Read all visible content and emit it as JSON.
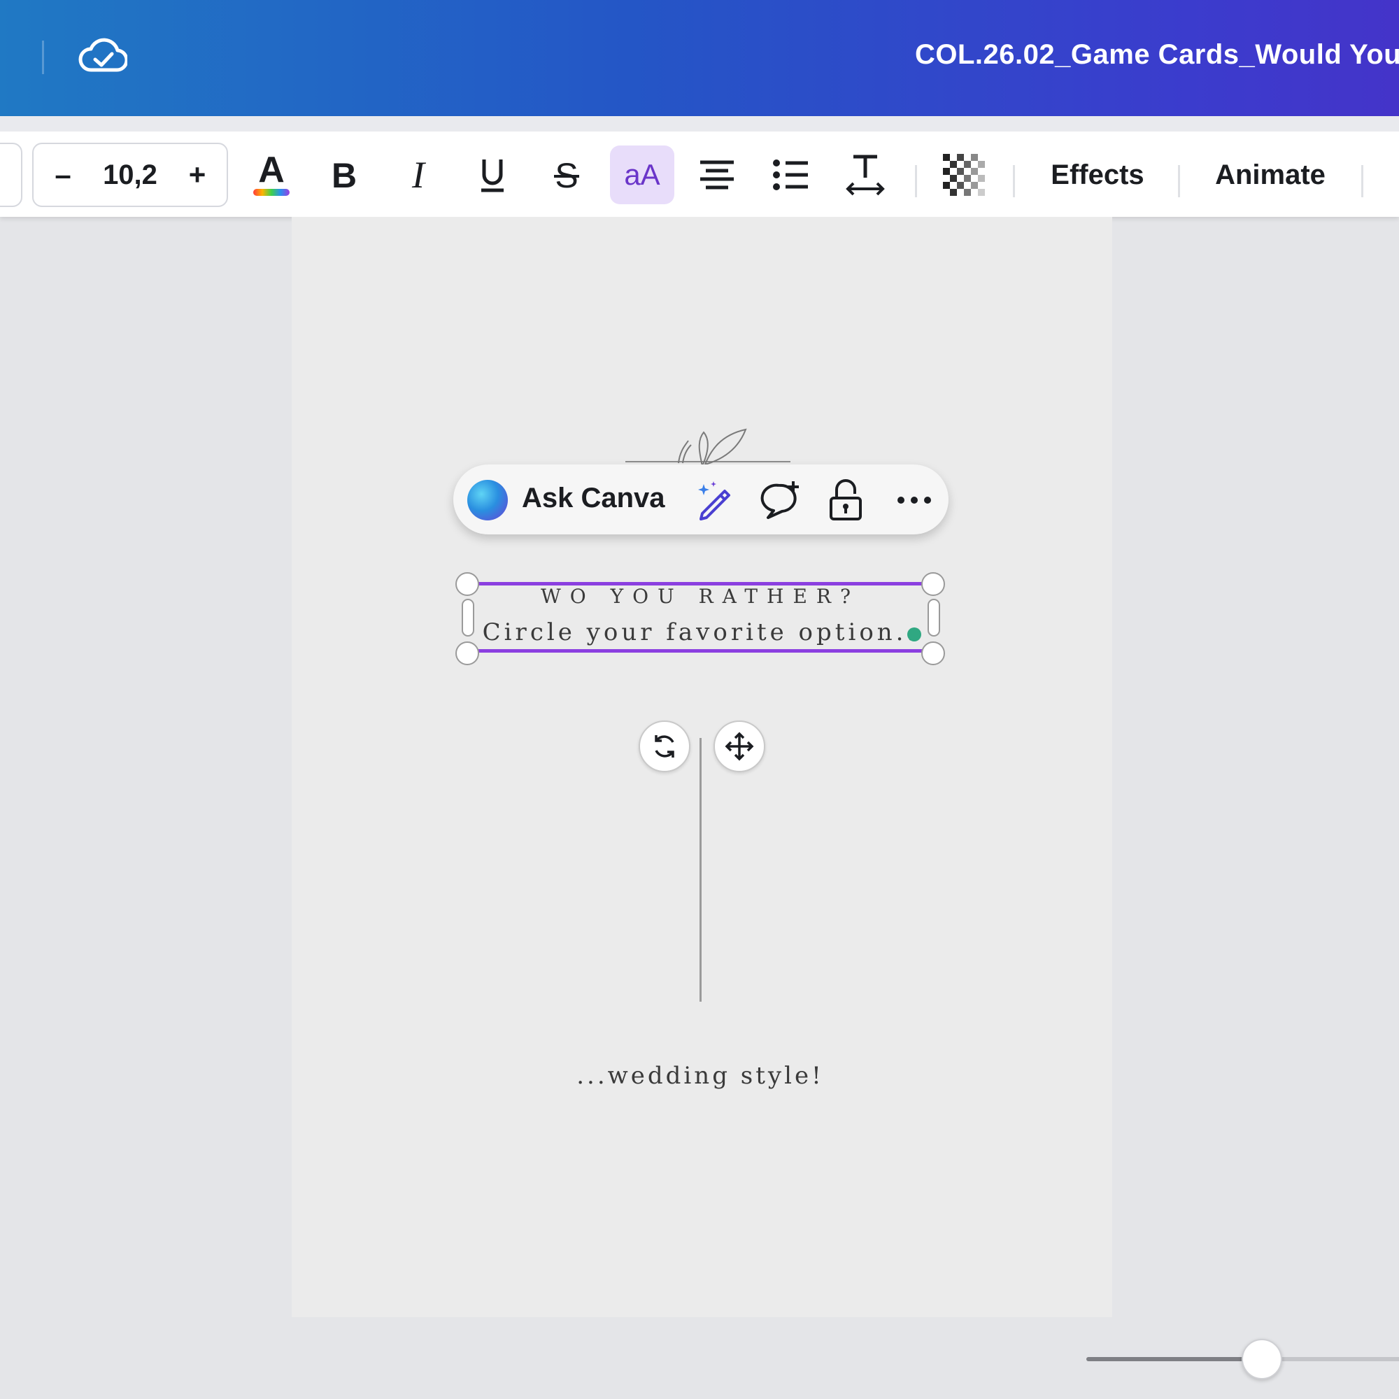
{
  "header": {
    "doc_title": "COL.26.02_Game Cards_Would You",
    "save_status_icon": "cloud-check-icon"
  },
  "toolbar": {
    "font_size": "10,2",
    "decrease_label": "–",
    "increase_label": "+",
    "case_label": "aA",
    "effects_label": "Effects",
    "animate_label": "Animate"
  },
  "context_menu": {
    "ask_label": "Ask Canva"
  },
  "card": {
    "heading": "WO YOU RATHER?",
    "subheading": "Circle your favorite option..",
    "footer_text": "...wedding style!"
  },
  "zoom": {
    "level_fraction": 0.55
  },
  "colors": {
    "selection": "#8b3fe0",
    "accent_case_bg": "#e8ddfa",
    "handle_dot": "#30a882"
  }
}
